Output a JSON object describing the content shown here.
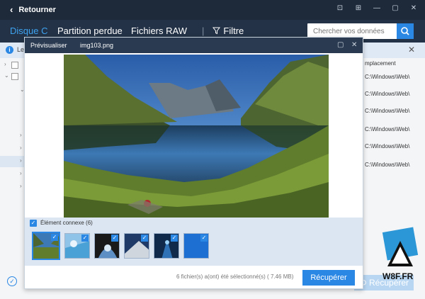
{
  "topbar": {
    "back_label": "Retourner"
  },
  "nav": {
    "tabs": [
      {
        "label": "Disque C"
      },
      {
        "label": "Partition perdue"
      },
      {
        "label": "Fichiers RAW"
      }
    ],
    "filter_label": "Filtre",
    "search_placeholder": "Chercher vos données"
  },
  "infobar": {
    "text": "Le"
  },
  "rightcol": {
    "header": "mplacement",
    "rows": [
      "C:\\Windows\\Web\\",
      "C:\\Windows\\Web\\",
      "C:\\Windows\\Web\\",
      "C:\\Windows\\Web\\",
      "C:\\Windows\\Web\\",
      "C:\\Windows\\Web\\"
    ]
  },
  "background_recover_label": "Récupérer",
  "dialog": {
    "title": "Prévisualiser",
    "filename": "img103.png",
    "related_label": "Élément connexe (6)",
    "status": "6 fichier(s) a(ont) été sélectionné(s) ( 7.46 MB)",
    "recover_label": "Récupérer"
  },
  "watermark": {
    "text": "W8F.FR"
  },
  "colors": {
    "accent": "#2b87e4",
    "dark": "#1e2a3a"
  }
}
